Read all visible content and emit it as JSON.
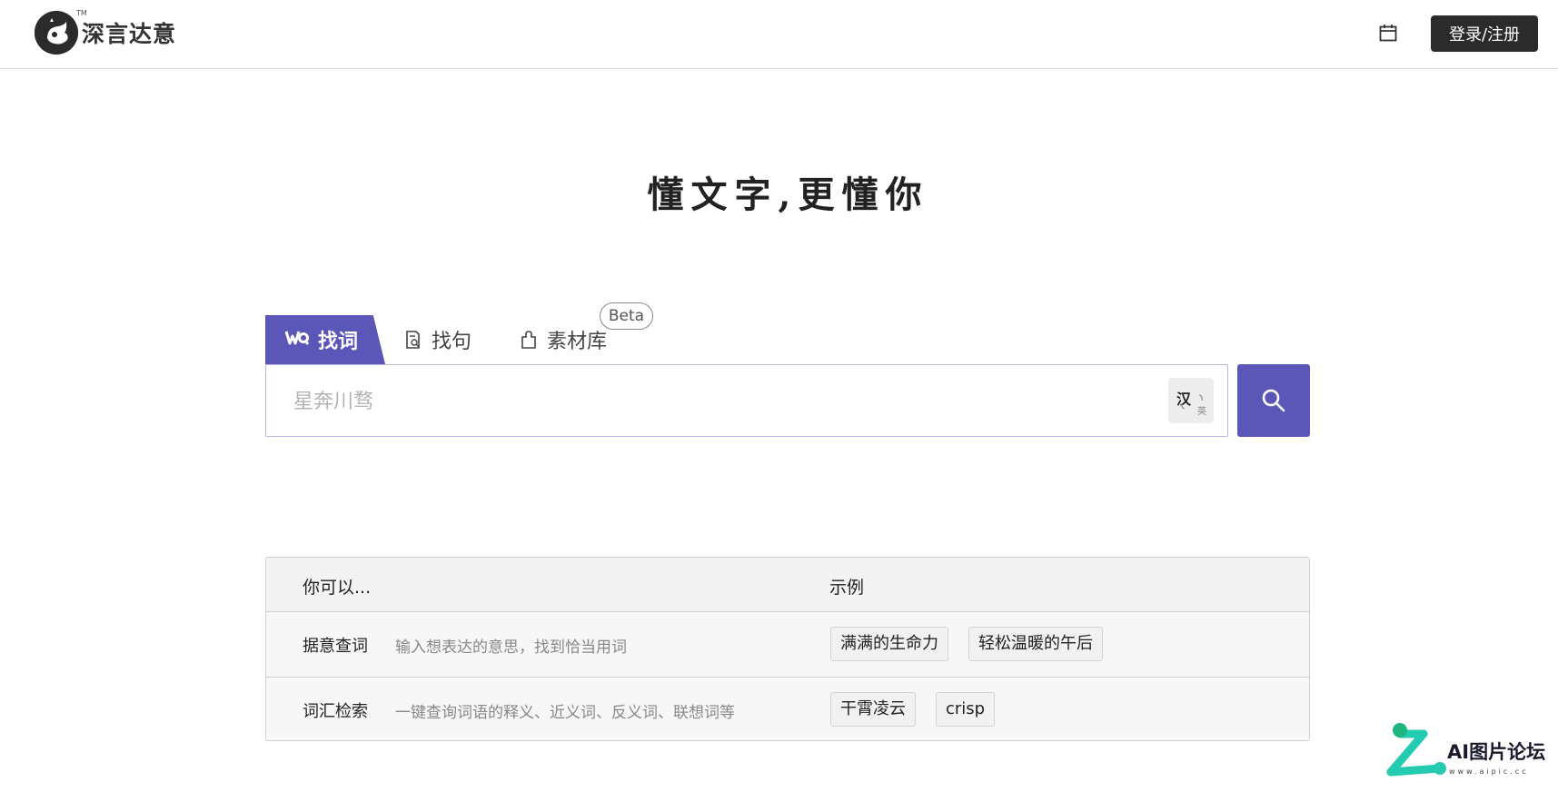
{
  "header": {
    "brand": "深言达意",
    "trademark": "TM",
    "login_label": "登录/注册"
  },
  "slogan": "懂文字,更懂你",
  "tabs": [
    {
      "label": "找词",
      "icon": "wq-logo-icon",
      "active": true
    },
    {
      "label": "找句",
      "icon": "document-search-icon",
      "active": false
    },
    {
      "label": "素材库",
      "icon": "puzzle-icon",
      "active": false,
      "badge": "Beta"
    }
  ],
  "search": {
    "placeholder": "星奔川骛",
    "lang_primary": "汉",
    "lang_secondary": "英"
  },
  "guide": {
    "col_left": "你可以...",
    "col_right": "示例",
    "rows": [
      {
        "title": "据意查词",
        "desc": "输入想表达的意思，找到恰当用词",
        "examples": [
          "满满的生命力",
          "轻松温暖的午后"
        ]
      },
      {
        "title": "词汇检索",
        "desc": "一键查询词语的释义、近义词、反义词、联想词等",
        "examples": [
          "干霄凌云",
          "crisp"
        ]
      }
    ]
  },
  "watermark": {
    "text": "AI图片论坛",
    "url": "www.aipic.cc"
  },
  "colors": {
    "accent": "#5a57b8",
    "dark": "#2b2b2b"
  }
}
